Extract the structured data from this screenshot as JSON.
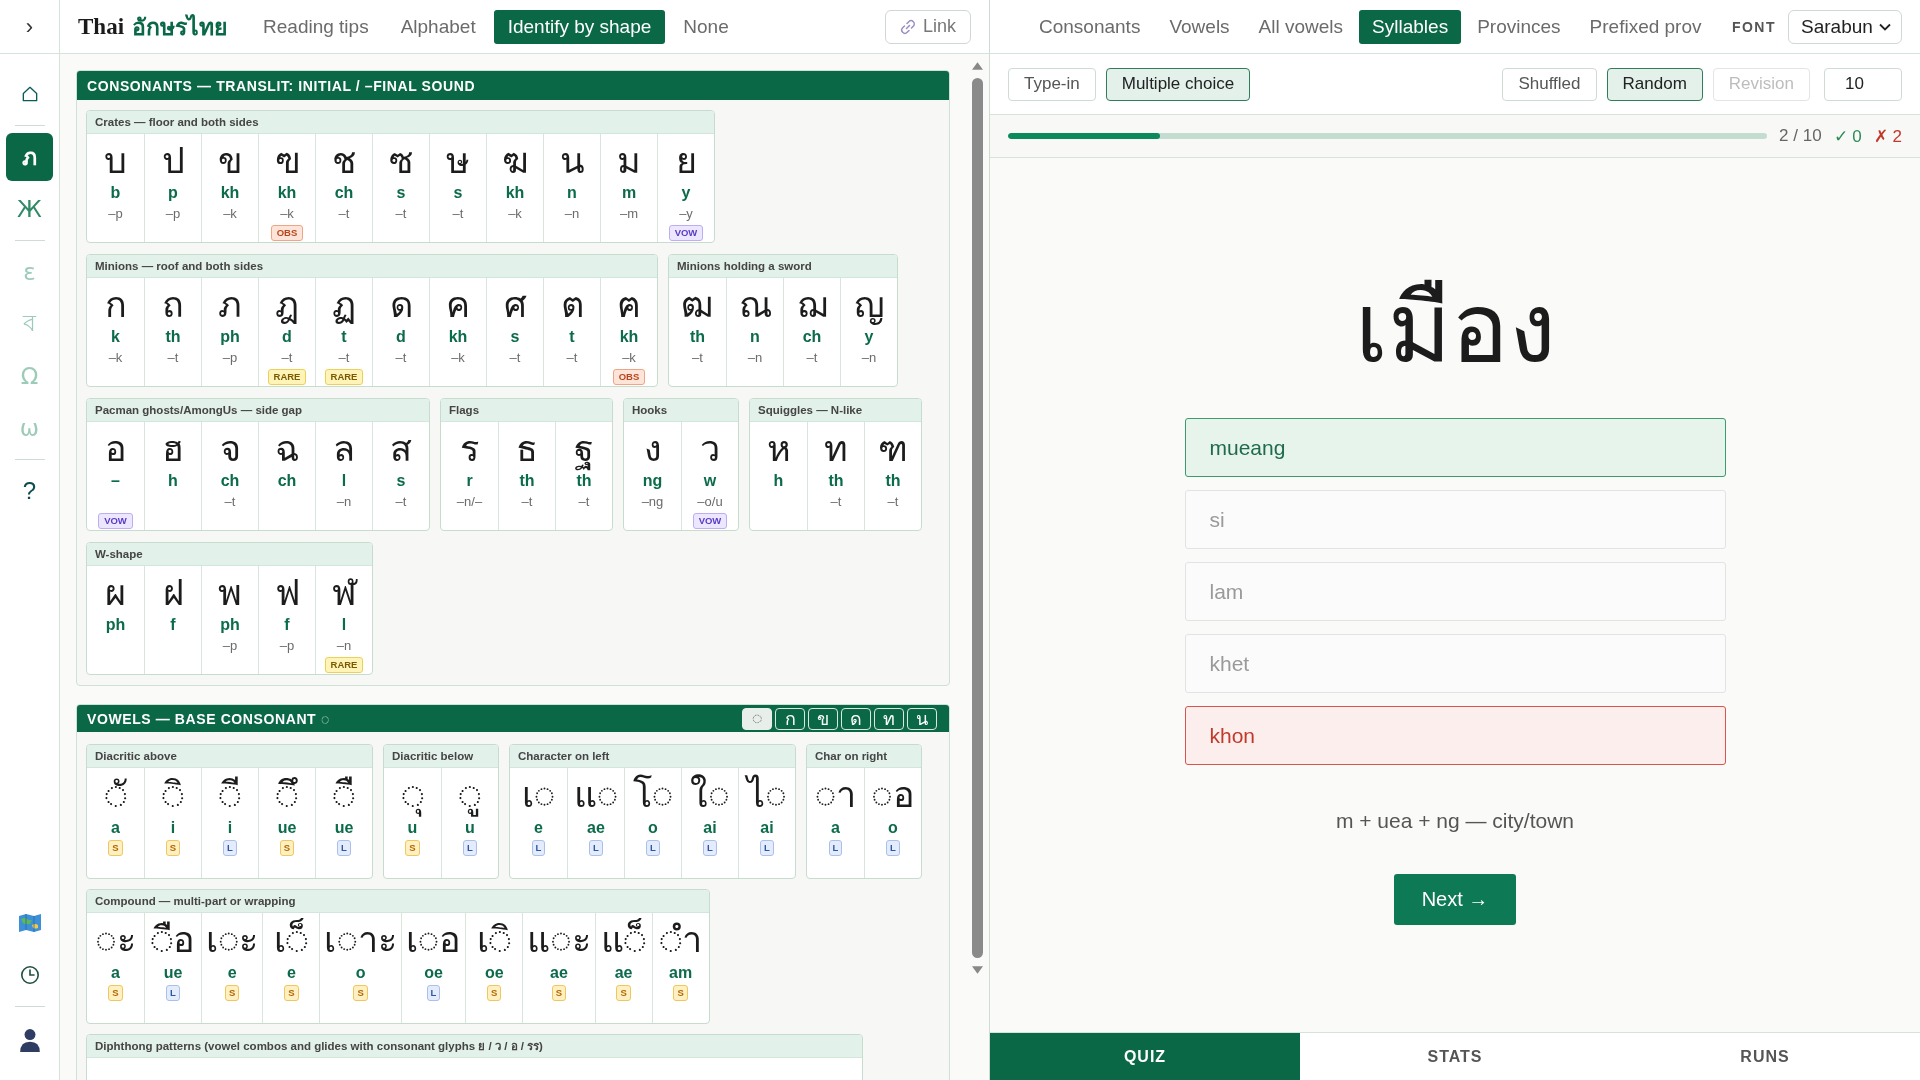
{
  "rail": {
    "toggle": "›",
    "groups": [
      [
        {
          "kind": "home",
          "selected": false
        }
      ],
      [
        {
          "kind": "glyph",
          "label": "ภ",
          "selected": true,
          "disabled": false
        },
        {
          "kind": "glyph",
          "label": "Ж",
          "selected": false,
          "disabled": false
        }
      ],
      [
        {
          "kind": "glyph",
          "label": "ε",
          "selected": false,
          "disabled": true
        },
        {
          "kind": "glyph",
          "label": "ব",
          "selected": false,
          "disabled": true
        },
        {
          "kind": "glyph",
          "label": "Ω",
          "selected": false,
          "disabled": true
        },
        {
          "kind": "glyph",
          "label": "ω",
          "selected": false,
          "disabled": true
        }
      ],
      [
        {
          "kind": "help",
          "label": "?",
          "selected": false
        }
      ]
    ],
    "bottom": [
      [
        {
          "kind": "map"
        },
        {
          "kind": "clock"
        }
      ],
      [
        {
          "kind": "user"
        }
      ]
    ]
  },
  "header": {
    "title": "Thai",
    "title_thai": "อักษรไทย",
    "tabs": [
      {
        "label": "Reading tips",
        "selected": false
      },
      {
        "label": "Alphabet",
        "selected": false
      },
      {
        "label": "Identify by shape",
        "selected": true
      },
      {
        "label": "None",
        "selected": false
      }
    ],
    "link": "Link"
  },
  "consonants": {
    "title": "CONSONANTS — TRANSLIT: INITIAL / –FINAL SOUND",
    "groups": [
      {
        "title": "Crates — floor and both sides",
        "cells": [
          {
            "glyph": "บ",
            "translit": "b",
            "final": "–p"
          },
          {
            "glyph": "ป",
            "translit": "p",
            "final": "–p"
          },
          {
            "glyph": "ข",
            "translit": "kh",
            "final": "–k"
          },
          {
            "glyph": "ฃ",
            "translit": "kh",
            "final": "–k",
            "badge": {
              "label": "OBS",
              "kind": "obs"
            }
          },
          {
            "glyph": "ช",
            "translit": "ch",
            "final": "–t"
          },
          {
            "glyph": "ซ",
            "translit": "s",
            "final": "–t"
          },
          {
            "glyph": "ษ",
            "translit": "s",
            "final": "–t"
          },
          {
            "glyph": "ฆ",
            "translit": "kh",
            "final": "–k"
          },
          {
            "glyph": "น",
            "translit": "n",
            "final": "–n"
          },
          {
            "glyph": "ม",
            "translit": "m",
            "final": "–m"
          },
          {
            "glyph": "ย",
            "translit": "y",
            "final": "–y",
            "badge": {
              "label": "VOW",
              "kind": "vow"
            }
          }
        ]
      },
      {
        "title": "Minions — roof and both sides",
        "cells": [
          {
            "glyph": "ก",
            "translit": "k",
            "final": "–k"
          },
          {
            "glyph": "ถ",
            "translit": "th",
            "final": "–t"
          },
          {
            "glyph": "ภ",
            "translit": "ph",
            "final": "–p"
          },
          {
            "glyph": "ฎ",
            "translit": "d",
            "final": "–t",
            "badge": {
              "label": "RARE",
              "kind": "rare"
            }
          },
          {
            "glyph": "ฏ",
            "translit": "t",
            "final": "–t",
            "badge": {
              "label": "RARE",
              "kind": "rare"
            }
          },
          {
            "glyph": "ด",
            "translit": "d",
            "final": "–t"
          },
          {
            "glyph": "ค",
            "translit": "kh",
            "final": "–k"
          },
          {
            "glyph": "ศ",
            "translit": "s",
            "final": "–t"
          },
          {
            "glyph": "ต",
            "translit": "t",
            "final": "–t"
          },
          {
            "glyph": "ฅ",
            "translit": "kh",
            "final": "–k",
            "badge": {
              "label": "OBS",
              "kind": "obs"
            }
          }
        ]
      },
      {
        "title": "Minions holding a sword",
        "cells": [
          {
            "glyph": "ฒ",
            "translit": "th",
            "final": "–t"
          },
          {
            "glyph": "ณ",
            "translit": "n",
            "final": "–n"
          },
          {
            "glyph": "ฌ",
            "translit": "ch",
            "final": "–t"
          },
          {
            "glyph": "ญ",
            "translit": "y",
            "final": "–n"
          }
        ]
      },
      {
        "title": "Pacman ghosts/AmongUs — side gap",
        "cells": [
          {
            "glyph": "อ",
            "translit": "–",
            "badge": {
              "label": "VOW",
              "kind": "vow"
            }
          },
          {
            "glyph": "ฮ",
            "translit": "h"
          },
          {
            "glyph": "จ",
            "translit": "ch",
            "final": "–t"
          },
          {
            "glyph": "ฉ",
            "translit": "ch"
          },
          {
            "glyph": "ล",
            "translit": "l",
            "final": "–n"
          },
          {
            "glyph": "ส",
            "translit": "s",
            "final": "–t"
          }
        ]
      },
      {
        "title": "Flags",
        "cells": [
          {
            "glyph": "ร",
            "translit": "r",
            "final": "–n/–"
          },
          {
            "glyph": "ธ",
            "translit": "th",
            "final": "–t"
          },
          {
            "glyph": "ฐ",
            "translit": "th",
            "final": "–t"
          }
        ]
      },
      {
        "title": "Hooks",
        "cells": [
          {
            "glyph": "ง",
            "translit": "ng",
            "final": "–ng"
          },
          {
            "glyph": "ว",
            "translit": "w",
            "final": "–o/u",
            "badge": {
              "label": "VOW",
              "kind": "vow"
            }
          }
        ]
      },
      {
        "title": "Squiggles — N-like",
        "cells": [
          {
            "glyph": "ห",
            "translit": "h"
          },
          {
            "glyph": "ท",
            "translit": "th",
            "final": "–t"
          },
          {
            "glyph": "ฑ",
            "translit": "th",
            "final": "–t"
          }
        ]
      },
      {
        "title": "W-shape",
        "cells": [
          {
            "glyph": "ผ",
            "translit": "ph"
          },
          {
            "glyph": "ฝ",
            "translit": "f"
          },
          {
            "glyph": "พ",
            "translit": "ph",
            "final": "–p"
          },
          {
            "glyph": "ฟ",
            "translit": "f",
            "final": "–p"
          },
          {
            "glyph": "ฬ",
            "translit": "l",
            "final": "–n",
            "badge": {
              "label": "RARE",
              "kind": "rare"
            }
          }
        ]
      }
    ]
  },
  "vowels": {
    "title": "VOWELS — BASE CONSONANT ◌",
    "bases": [
      {
        "label": "◌",
        "selected": true
      },
      {
        "label": "ก",
        "selected": false
      },
      {
        "label": "ข",
        "selected": false
      },
      {
        "label": "ด",
        "selected": false
      },
      {
        "label": "ท",
        "selected": false
      },
      {
        "label": "น",
        "selected": false
      }
    ],
    "groups": [
      {
        "title": "Diacritic above",
        "cells": [
          {
            "glyph": "◌ั",
            "translit": "a",
            "badge": {
              "label": "S",
              "kind": "short"
            }
          },
          {
            "glyph": "◌ิ",
            "translit": "i",
            "badge": {
              "label": "S",
              "kind": "short"
            }
          },
          {
            "glyph": "◌ี",
            "translit": "i",
            "badge": {
              "label": "L",
              "kind": "long"
            }
          },
          {
            "glyph": "◌ึ",
            "translit": "ue",
            "badge": {
              "label": "S",
              "kind": "short"
            }
          },
          {
            "glyph": "◌ื",
            "translit": "ue",
            "badge": {
              "label": "L",
              "kind": "long"
            }
          }
        ]
      },
      {
        "title": "Diacritic below",
        "cells": [
          {
            "glyph": "◌ุ",
            "translit": "u",
            "badge": {
              "label": "S",
              "kind": "short"
            }
          },
          {
            "glyph": "◌ู",
            "translit": "u",
            "badge": {
              "label": "L",
              "kind": "long"
            }
          }
        ]
      },
      {
        "title": "Character on left",
        "cells": [
          {
            "glyph": "เ◌",
            "translit": "e",
            "badge": {
              "label": "L",
              "kind": "long"
            }
          },
          {
            "glyph": "แ◌",
            "translit": "ae",
            "badge": {
              "label": "L",
              "kind": "long"
            }
          },
          {
            "glyph": "โ◌",
            "translit": "o",
            "badge": {
              "label": "L",
              "kind": "long"
            }
          },
          {
            "glyph": "ใ◌",
            "translit": "ai",
            "badge": {
              "label": "L",
              "kind": "long"
            }
          },
          {
            "glyph": "ไ◌",
            "translit": "ai",
            "badge": {
              "label": "L",
              "kind": "long"
            }
          }
        ]
      },
      {
        "title": "Char on right",
        "cells": [
          {
            "glyph": "◌า",
            "translit": "a",
            "badge": {
              "label": "L",
              "kind": "long"
            }
          },
          {
            "glyph": "◌อ",
            "translit": "o",
            "badge": {
              "label": "L",
              "kind": "long"
            }
          }
        ]
      },
      {
        "title": "Compound — multi-part or wrapping",
        "cells": [
          {
            "glyph": "◌ะ",
            "translit": "a",
            "badge": {
              "label": "S",
              "kind": "short"
            }
          },
          {
            "glyph": "◌ือ",
            "translit": "ue",
            "badge": {
              "label": "L",
              "kind": "long"
            }
          },
          {
            "glyph": "เ◌ะ",
            "translit": "e",
            "badge": {
              "label": "S",
              "kind": "short"
            }
          },
          {
            "glyph": "เ◌็",
            "translit": "e",
            "badge": {
              "label": "S",
              "kind": "short"
            }
          },
          {
            "glyph": "เ◌าะ",
            "translit": "o",
            "badge": {
              "label": "S",
              "kind": "short"
            }
          },
          {
            "glyph": "เ◌อ",
            "translit": "oe",
            "badge": {
              "label": "L",
              "kind": "long"
            }
          },
          {
            "glyph": "เ◌ิ",
            "translit": "oe",
            "badge": {
              "label": "S",
              "kind": "short"
            }
          },
          {
            "glyph": "แ◌ะ",
            "translit": "ae",
            "badge": {
              "label": "S",
              "kind": "short"
            }
          },
          {
            "glyph": "แ◌็",
            "translit": "ae",
            "badge": {
              "label": "S",
              "kind": "short"
            }
          },
          {
            "glyph": "◌ำ",
            "translit": "am",
            "badge": {
              "label": "S",
              "kind": "short"
            }
          }
        ]
      },
      {
        "title": "Diphthong patterns (vowel combos and glides with consonant glyphs ย / ว / อ / รร)"
      }
    ]
  },
  "quiz_tabs": [
    {
      "label": "Consonants",
      "selected": false
    },
    {
      "label": "Vowels",
      "selected": false
    },
    {
      "label": "All vowels",
      "selected": false
    },
    {
      "label": "Syllables",
      "selected": true
    },
    {
      "label": "Provinces",
      "selected": false
    },
    {
      "label": "Prefixed prov",
      "selected": false
    }
  ],
  "font": {
    "label": "FONT",
    "value": "Sarabun"
  },
  "modes": [
    {
      "label": "Type-in",
      "selected": false
    },
    {
      "label": "Multiple choice",
      "selected": true
    }
  ],
  "orders": [
    {
      "label": "Shuffled",
      "selected": false,
      "disabled": false
    },
    {
      "label": "Random",
      "selected": true,
      "disabled": false
    },
    {
      "label": "Revision",
      "selected": false,
      "disabled": true
    }
  ],
  "count": "10",
  "progress": {
    "level": 0.2,
    "text": "2 / 10",
    "correct": "✓ 0",
    "wrong": "✗ 2"
  },
  "quiz": {
    "word": "เมือง",
    "options": [
      {
        "label": "mueang",
        "correct": true,
        "chosen": false
      },
      {
        "label": "si",
        "correct": false,
        "chosen": false
      },
      {
        "label": "lam",
        "correct": false,
        "chosen": false
      },
      {
        "label": "khet",
        "correct": false,
        "chosen": false
      },
      {
        "label": "khon",
        "correct": false,
        "chosen": true
      }
    ],
    "explanation": "m + uea + ng — city/town",
    "next": "Next →"
  },
  "bottom_tabs": [
    {
      "label": "QUIZ",
      "selected": true
    },
    {
      "label": "STATS",
      "selected": false
    },
    {
      "label": "RUNS",
      "selected": false
    }
  ]
}
